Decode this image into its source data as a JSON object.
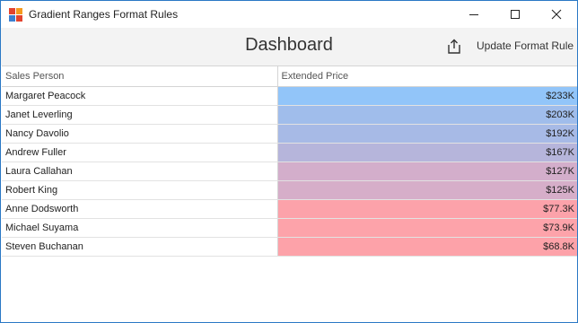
{
  "window": {
    "title": "Gradient Ranges Format Rules",
    "controls": [
      "minimize",
      "maximize",
      "close"
    ]
  },
  "toolbar": {
    "title": "Dashboard",
    "export_icon": "export-icon",
    "update_label": "Update Format Rule"
  },
  "grid": {
    "columns": [
      "Sales Person",
      "Extended Price"
    ],
    "rows": [
      {
        "person": "Margaret Peacock",
        "price": "$233K",
        "color": "#92c5f9"
      },
      {
        "person": "Janet Leverling",
        "price": "$203K",
        "color": "#a0bdeb"
      },
      {
        "person": "Nancy Davolio",
        "price": "$192K",
        "color": "#a7bae6"
      },
      {
        "person": "Andrew Fuller",
        "price": "$167K",
        "color": "#b6b5db"
      },
      {
        "person": "Laura Callahan",
        "price": "$127K",
        "color": "#d3aecb"
      },
      {
        "person": "Robert King",
        "price": "$125K",
        "color": "#d6aec9"
      },
      {
        "person": "Anne Dodsworth",
        "price": "$77.3K",
        "color": "#fca2aa"
      },
      {
        "person": "Michael Suyama",
        "price": "$73.9K",
        "color": "#fda3aa"
      },
      {
        "person": "Steven Buchanan",
        "price": "$68.8K",
        "color": "#fda2a9"
      }
    ]
  },
  "colors": {
    "accent": "#2b78c5",
    "icon_red": "#e3432e",
    "icon_orange": "#f59a1e",
    "icon_blue": "#3b7fd1"
  }
}
